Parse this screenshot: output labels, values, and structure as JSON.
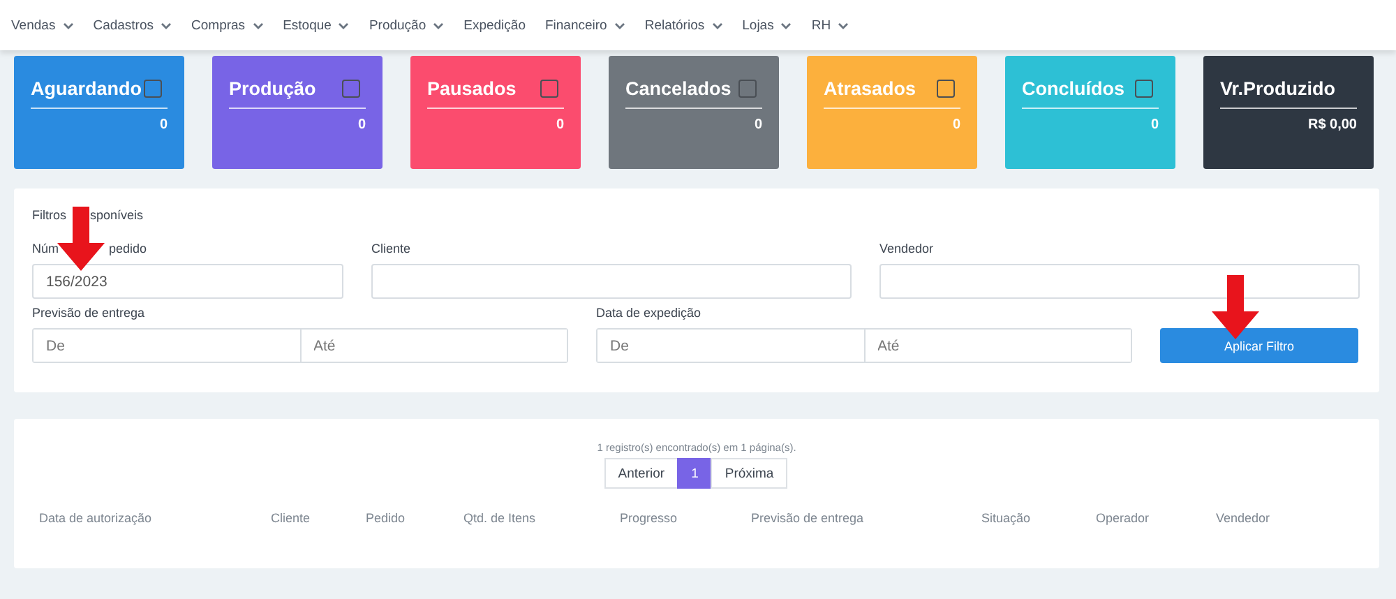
{
  "nav": [
    {
      "label": "Vendas",
      "dropdown": true
    },
    {
      "label": "Cadastros",
      "dropdown": true
    },
    {
      "label": "Compras",
      "dropdown": true
    },
    {
      "label": "Estoque",
      "dropdown": true
    },
    {
      "label": "Produção",
      "dropdown": true
    },
    {
      "label": "Expedição",
      "dropdown": false
    },
    {
      "label": "Financeiro",
      "dropdown": true
    },
    {
      "label": "Relatórios",
      "dropdown": true
    },
    {
      "label": "Lojas",
      "dropdown": true
    },
    {
      "label": "RH",
      "dropdown": true
    }
  ],
  "status_cards": [
    {
      "kind": "selectable",
      "title": "Aguardando",
      "value": "0",
      "color": "#2a8be0",
      "checked": false
    },
    {
      "kind": "selectable",
      "title": "Produção",
      "value": "0",
      "color": "#7864e6",
      "checked": false
    },
    {
      "kind": "selectable",
      "title": "Pausados",
      "value": "0",
      "color": "#fb4c6e",
      "checked": false
    },
    {
      "kind": "selectable",
      "title": "Cancelados",
      "value": "0",
      "color": "#6f767d",
      "checked": false
    },
    {
      "kind": "selectable",
      "title": "Atrasados",
      "value": "0",
      "color": "#fcb03d",
      "checked": false
    },
    {
      "kind": "selectable",
      "title": "Concluídos",
      "value": "0",
      "color": "#2dc0d5",
      "checked": false
    },
    {
      "kind": "total",
      "title": "Vr.Produzido",
      "value": "R$ 0,00",
      "color": "#2e3742"
    }
  ],
  "filters": {
    "title_parts": [
      "Filtros",
      "sponíveis"
    ],
    "order_number": {
      "label_parts": [
        "Núm",
        "pedido"
      ],
      "value": "156/2023"
    },
    "client": {
      "label": "Cliente"
    },
    "seller": {
      "label": "Vendedor"
    },
    "delivery_forecast": {
      "label": "Previsão de entrega",
      "from_placeholder": "De",
      "to_placeholder": "Até"
    },
    "dispatch_date": {
      "label": "Data de expedição",
      "from_placeholder": "De",
      "to_placeholder": "Até"
    },
    "apply_button": "Aplicar Filtro"
  },
  "results": {
    "summary": "1 registro(s) encontrado(s) em 1 página(s).",
    "pagination": [
      {
        "label": "Anterior",
        "selected": false
      },
      {
        "label": "1",
        "selected": true
      },
      {
        "label": "Próxima",
        "selected": false
      }
    ],
    "columns": [
      "Data de autorização",
      "Cliente",
      "Pedido",
      "Qtd. de Itens",
      "Progresso",
      "Previsão de entrega",
      "Situação",
      "Operador",
      "Vendedor"
    ]
  }
}
